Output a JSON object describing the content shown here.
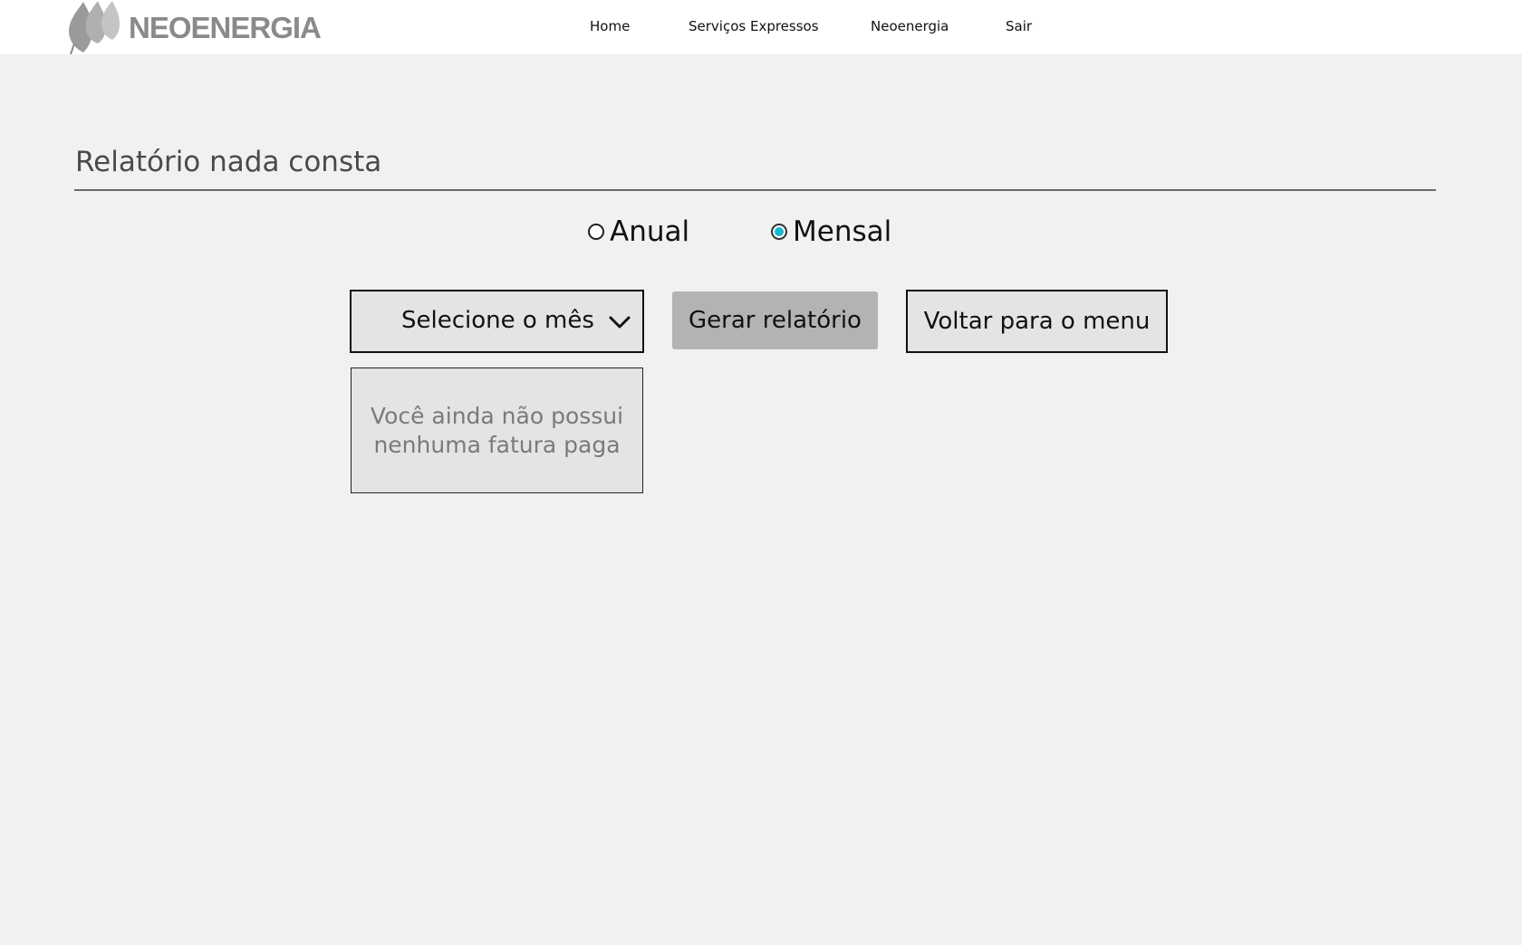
{
  "header": {
    "logo_text": "NEOENERGIA",
    "nav": [
      {
        "label": "Home"
      },
      {
        "label": "Serviços Expressos"
      },
      {
        "label": "Neoenergia"
      },
      {
        "label": "Sair"
      }
    ]
  },
  "main": {
    "title": "Relatório nada consta",
    "period_options": [
      {
        "label": "Anual",
        "checked": false
      },
      {
        "label": "Mensal",
        "checked": true
      }
    ],
    "month_select": {
      "selected": "Selecione o mês",
      "icon": "chevron-down-icon"
    },
    "generate_button": "Gerar relatório",
    "back_button": "Voltar para o menu",
    "empty_message": "Você ainda não possui nenhuma fatura paga"
  },
  "colors": {
    "background": "#f1f1f1",
    "header_background": "#ffffff",
    "radio_checked": "#14b9d1",
    "generate_button": "#b3b3b3",
    "box_background": "#e4e4e4",
    "logo_gray": "#8a8a8a"
  }
}
